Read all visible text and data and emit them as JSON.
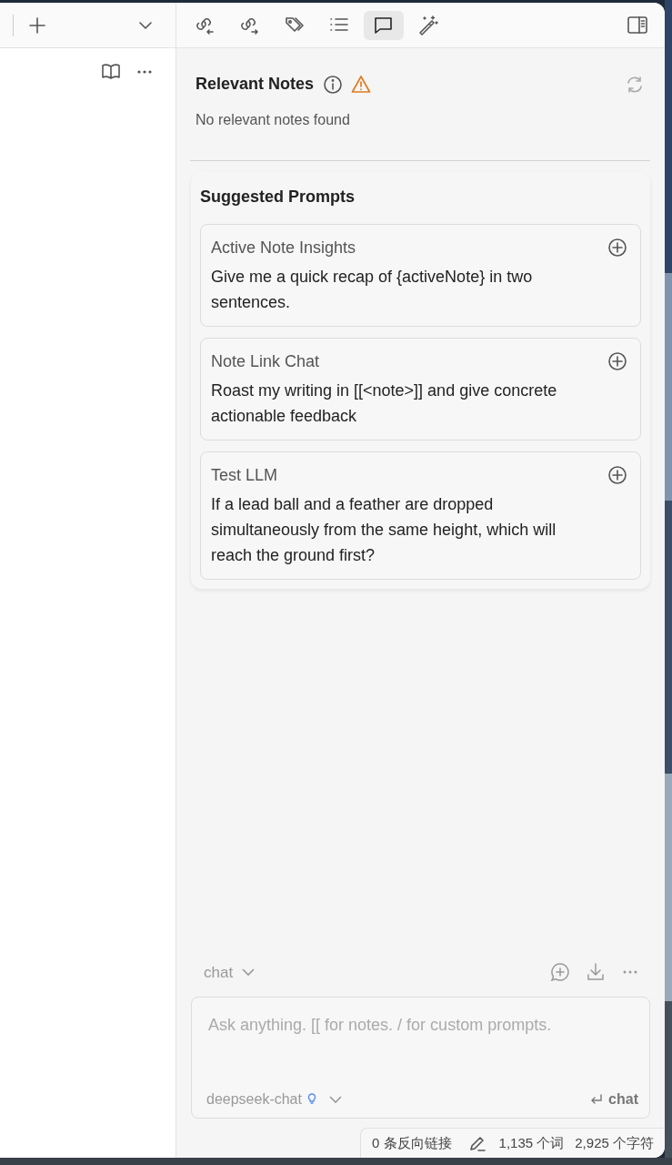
{
  "toolbar": {
    "tabs": [
      {
        "kind": "backlinks",
        "selected": false
      },
      {
        "kind": "outgoing",
        "selected": false
      },
      {
        "kind": "tags",
        "selected": false
      },
      {
        "kind": "outline",
        "selected": false
      },
      {
        "kind": "chat",
        "selected": true
      },
      {
        "kind": "magic",
        "selected": false
      }
    ]
  },
  "relevant_notes": {
    "title": "Relevant Notes",
    "message": "No relevant notes found"
  },
  "suggested_prompts": {
    "title": "Suggested Prompts",
    "items": [
      {
        "title": "Active Note Insights",
        "text": "Give me a quick recap of {activeNote} in two sentences."
      },
      {
        "title": "Note Link Chat",
        "text": "Roast my writing in [[<note>]] and give concrete actionable feedback"
      },
      {
        "title": "Test LLM",
        "text": "If a lead ball and a feather are dropped simultaneously from the same height, which will reach the ground first?"
      }
    ]
  },
  "chat_bar": {
    "mode": "chat"
  },
  "input": {
    "placeholder": "Ask anything. [[ for notes. / for custom prompts.",
    "model": "deepseek-chat",
    "send_label": "chat"
  },
  "status_bar": {
    "backlinks": "0 条反向链接",
    "words": "1,135 个词",
    "chars": "2,925 个字符"
  }
}
